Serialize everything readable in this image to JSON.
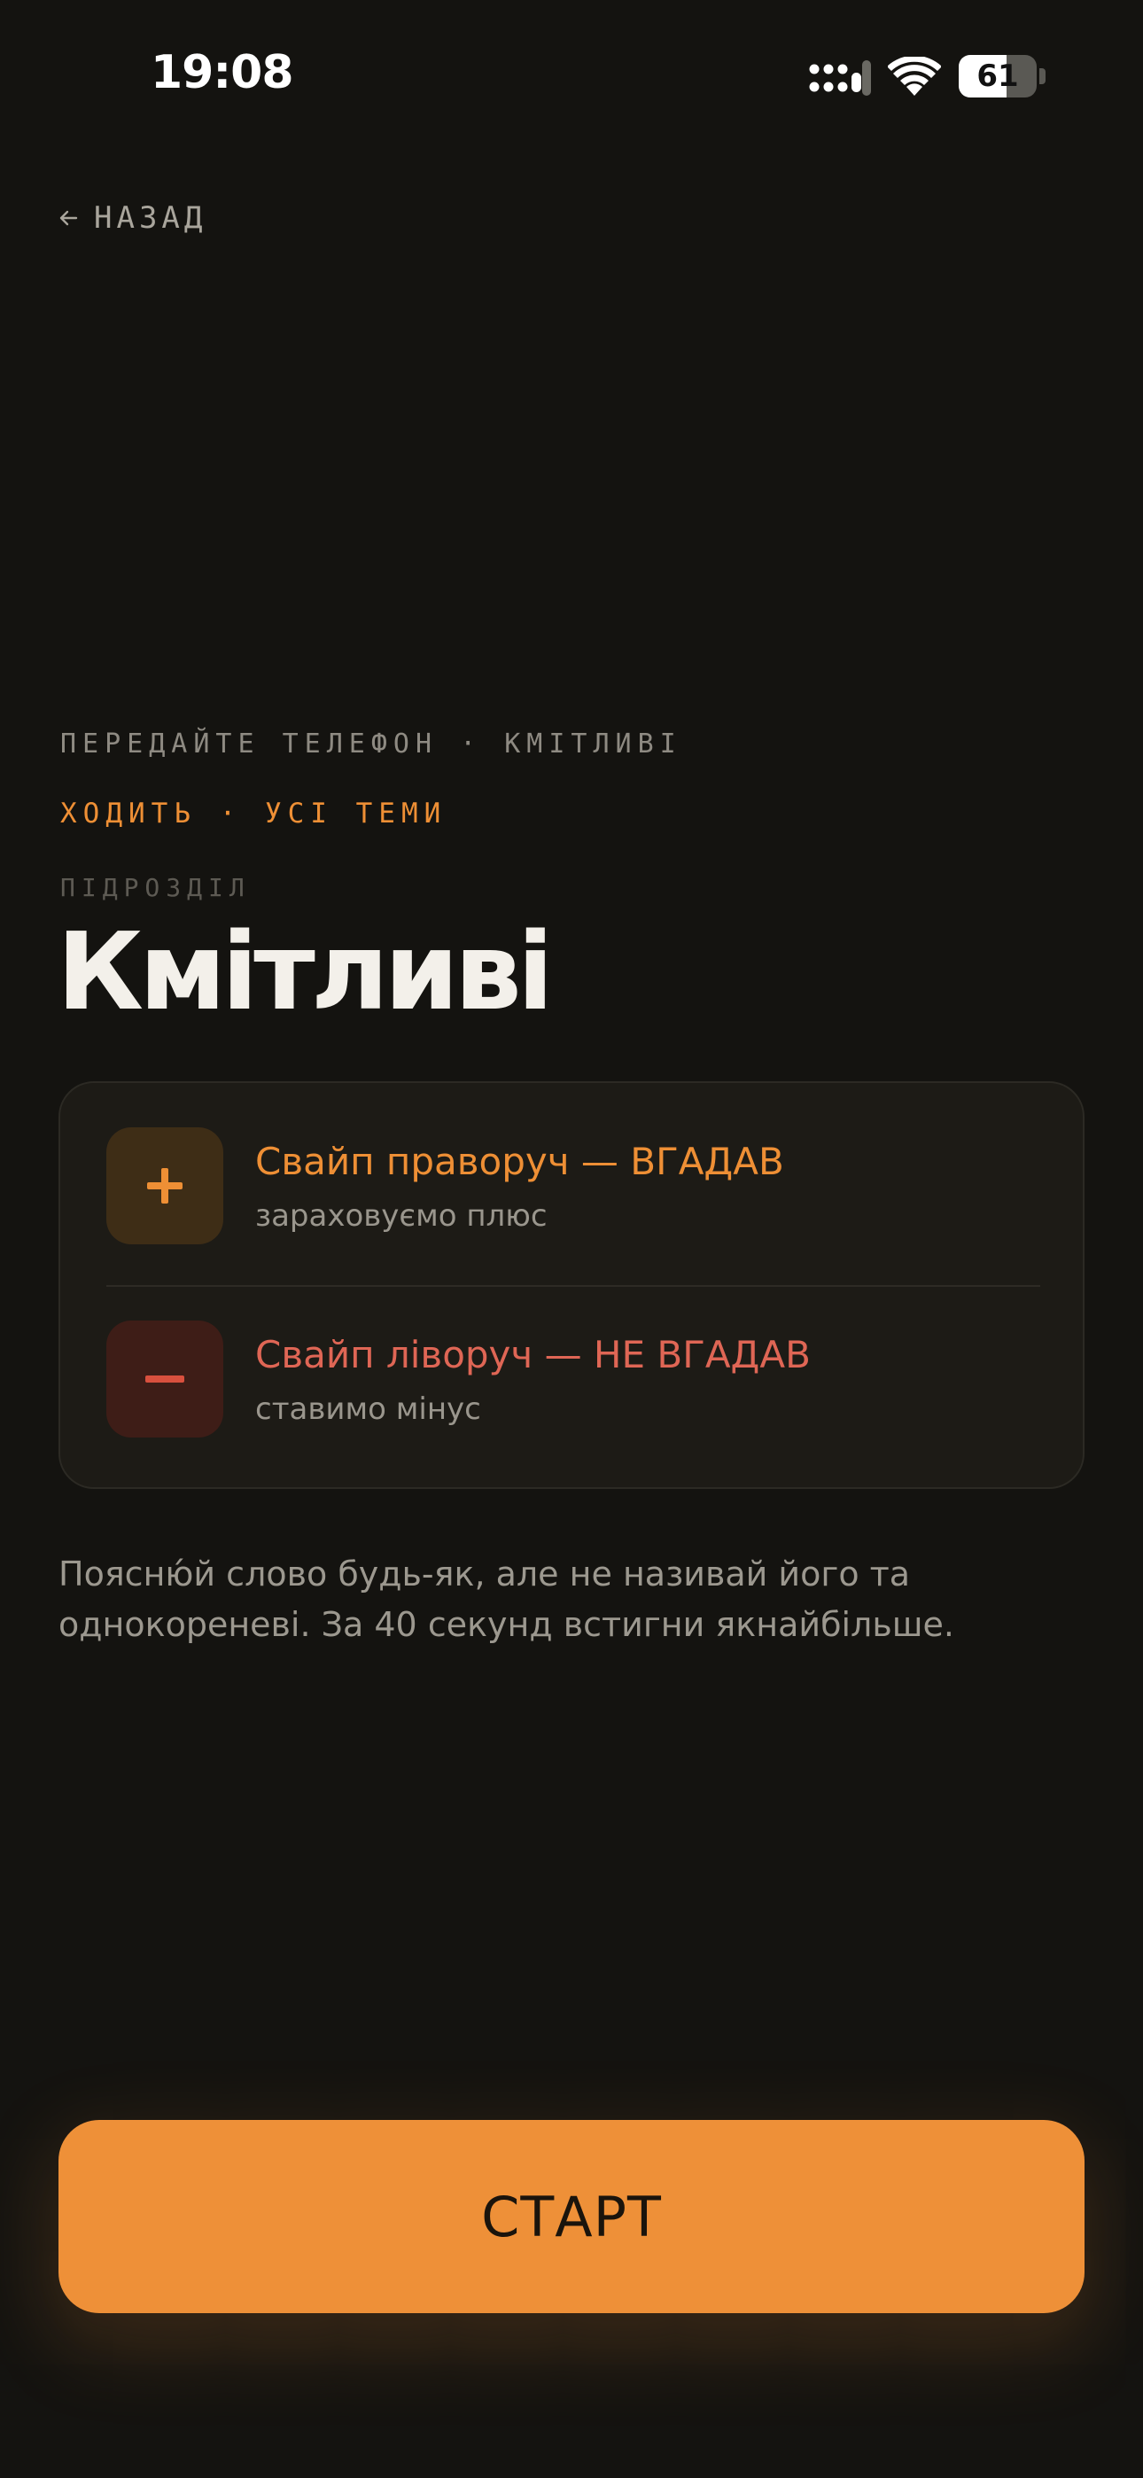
{
  "status_bar": {
    "time": "19:08",
    "battery_level": "61",
    "battery_fraction": 0.61,
    "icons": [
      "signal-icon",
      "wifi-icon",
      "battery-icon"
    ]
  },
  "nav": {
    "back_label": "НАЗАД",
    "back_icon": "arrow-left-icon"
  },
  "header": {
    "pass_phone_line": "ПЕРЕДАЙТЕ ТЕЛЕФОН · КМІТЛИВІ",
    "turn_line": "ХОДИТЬ · УСІ ТЕМИ",
    "subdivision_label": "ПІДРОЗДІЛ",
    "title": "Кмітливі"
  },
  "rules": {
    "plus": {
      "symbol_icon": "plus-icon",
      "title": "Свайп праворуч — ВГАДАВ",
      "subtitle": "зараховуємо плюс"
    },
    "minus": {
      "symbol_icon": "minus-icon",
      "title": "Свайп ліворуч — НЕ ВГАДАВ",
      "subtitle": "ставимо мінус"
    }
  },
  "description": "Поясню́й слово будь-як, але не називай його та однокореневі. За 40 секунд встигни якнайбільше.",
  "start_button_label": "СТАРТ",
  "colors": {
    "background": "#141310",
    "accent": "#ee9038",
    "negative": "#df6655",
    "card": "#1d1b16"
  }
}
